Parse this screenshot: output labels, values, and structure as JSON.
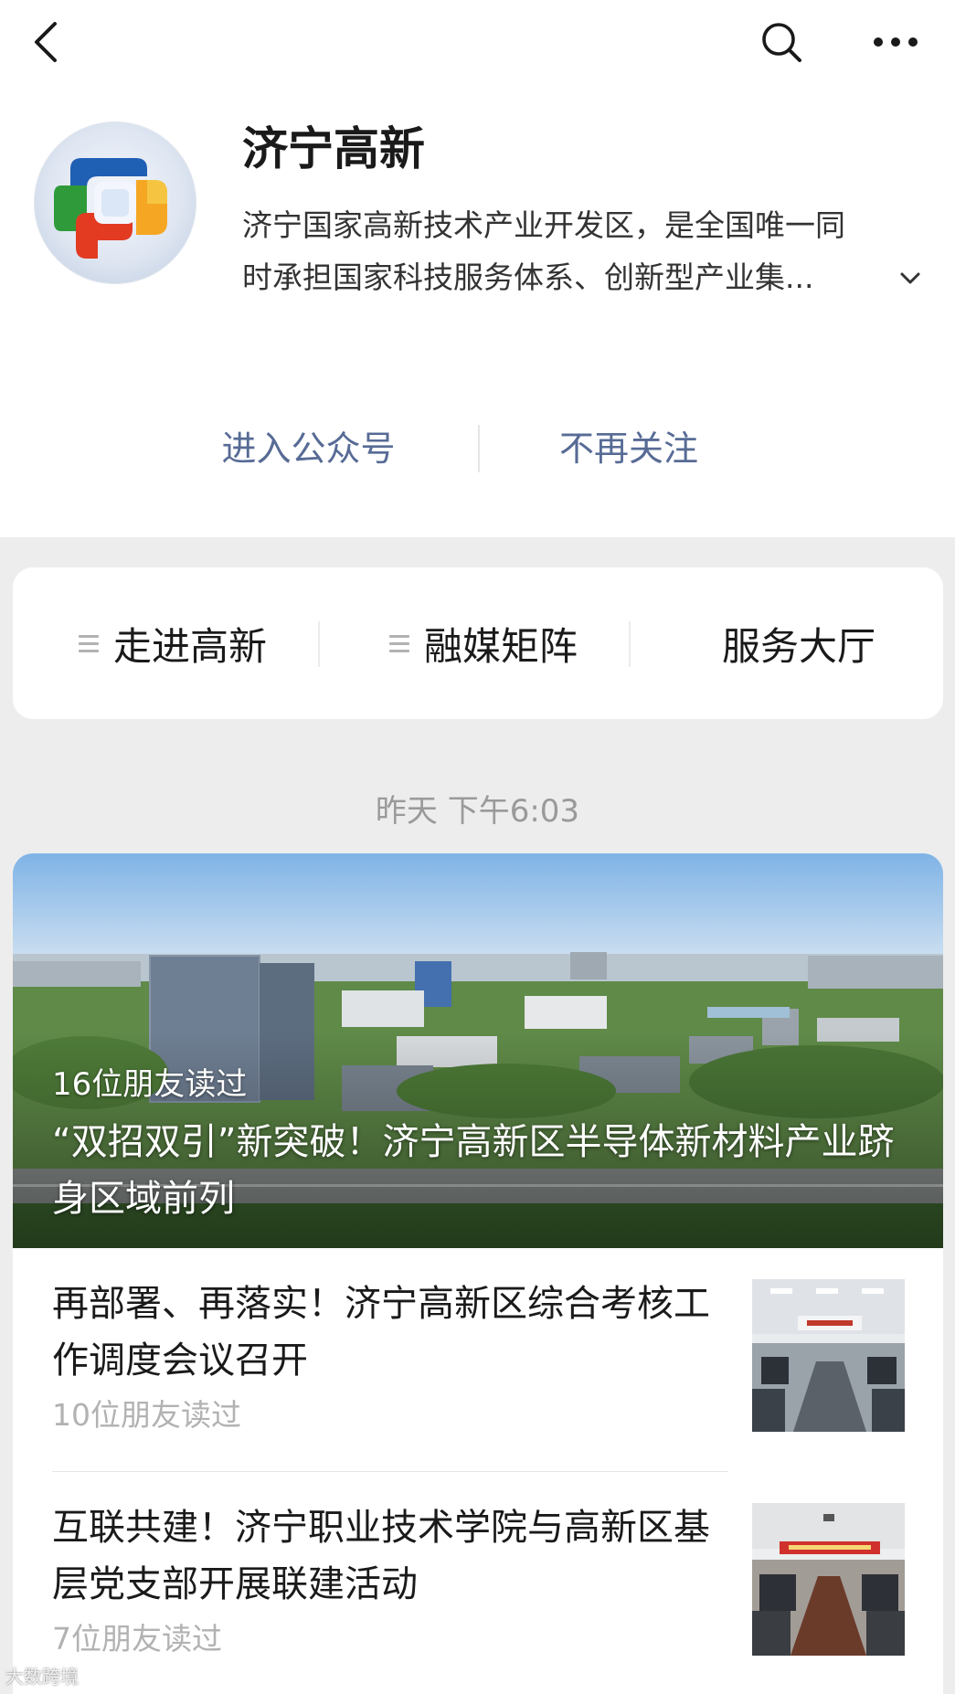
{
  "header": {
    "back_icon": "chevron-left-icon",
    "search_icon": "search-icon",
    "more_icon": "more-dots-icon"
  },
  "profile": {
    "name": "济宁高新",
    "description_line1": "济宁国家高新技术产业开发区，是全国唯一同",
    "description_line2": "时承担国家科技服务体系、创新型产业集...",
    "expand_icon": "chevron-down-icon",
    "logo_colors": [
      "#1f5fb4",
      "#2f9a3a",
      "#e23b22",
      "#f5b324"
    ]
  },
  "actions": {
    "enter_label": "进入公众号",
    "unfollow_label": "不再关注",
    "link_color": "#576b95"
  },
  "menu": {
    "items": [
      {
        "label": "走进高新",
        "has_submenu": true
      },
      {
        "label": "融媒矩阵",
        "has_submenu": true
      },
      {
        "label": "服务大厅",
        "has_submenu": false
      }
    ]
  },
  "feed": {
    "timestamp": "昨天 下午6:03",
    "cover": {
      "readers": "16位朋友读过",
      "title": "“双招双引”新突破！济宁高新区半导体新材料产业跻身区域前列"
    },
    "articles": [
      {
        "title": "再部署、再落实！济宁高新区综合考核工作调度会议召开",
        "readers": "10位朋友读过"
      },
      {
        "title": "互联共建！济宁职业技术学院与高新区基层党支部开展联建活动",
        "readers": "7位朋友读过"
      }
    ]
  },
  "watermark": "大数跨境"
}
